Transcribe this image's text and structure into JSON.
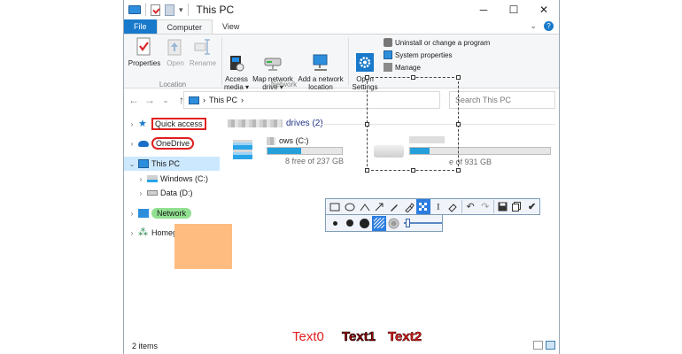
{
  "window": {
    "title": "This PC",
    "controls": {
      "minimize": "─",
      "maximize": "☐",
      "close": "✕"
    }
  },
  "ribbon": {
    "tabs": [
      {
        "label": "File"
      },
      {
        "label": "Computer"
      },
      {
        "label": "View"
      }
    ],
    "buttons": {
      "properties": "Properties",
      "open": "Open",
      "rename": "Rename",
      "access_media": "Access\nmedia ▾",
      "map_network_drive": "Map network\ndrive ▾",
      "add_network_location": "Add a network\nlocation",
      "open_settings": "Open\nSettings",
      "uninstall": "Uninstall or change a program",
      "system_properties": "System properties",
      "manage": "Manage"
    },
    "groups": {
      "location": "Location",
      "network": "Network"
    }
  },
  "navbar": {
    "breadcrumb": "This PC",
    "separator": "›",
    "search_placeholder": "Search This PC"
  },
  "navpane": {
    "items": [
      {
        "label": "Quick access"
      },
      {
        "label": "OneDrive"
      },
      {
        "label": "This PC"
      },
      {
        "label": "Windows (C:)"
      },
      {
        "label": "Data (D:)"
      },
      {
        "label": "Network"
      },
      {
        "label": "Homegroup"
      }
    ]
  },
  "content": {
    "section_title": "drives (2)",
    "drive_c": {
      "name": "ows (C:)",
      "free": "8 free of 237 GB",
      "used_fraction": 0.45
    },
    "drive_d": {
      "free": "e of 931 GB",
      "used_fraction": 0.14
    }
  },
  "toolbar": {
    "tools": [
      "rectangle",
      "ellipse",
      "line",
      "arrow",
      "pencil",
      "marker",
      "blur",
      "text",
      "eraser",
      "undo",
      "redo",
      "save",
      "copy",
      "done"
    ],
    "active_tool": "blur",
    "brush_sizes": [
      "small",
      "medium",
      "large"
    ]
  },
  "status": {
    "items_count": "2 items"
  },
  "annotations": {
    "text0": "Text0",
    "text1": "Text1",
    "text2": "Text2"
  },
  "colors": {
    "accent": "#1979ca",
    "annotation_red": "#e02020",
    "highlight_green": "#90e090",
    "highlight_orange": "#ffbc80",
    "selection": "#cce8ff"
  }
}
